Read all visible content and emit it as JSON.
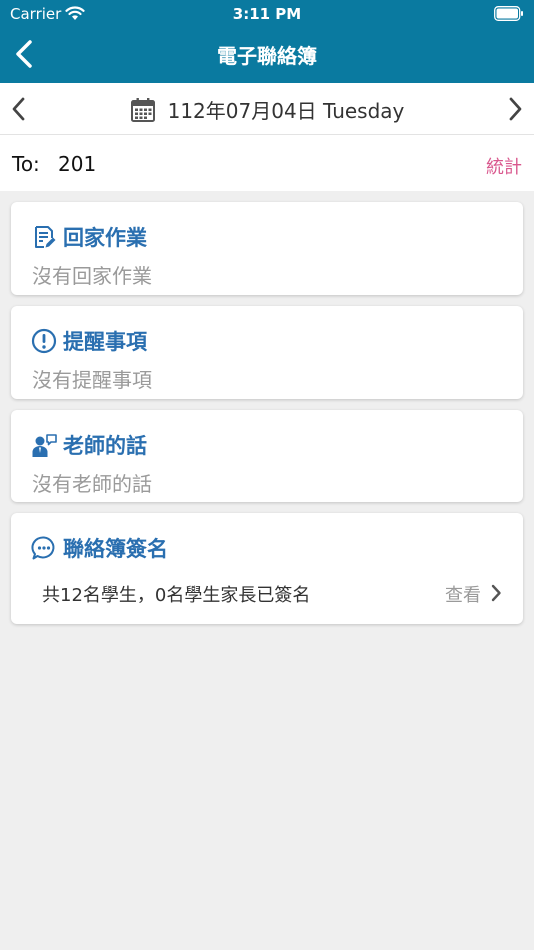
{
  "status_bar": {
    "carrier": "Carrier",
    "time": "3:11 PM"
  },
  "nav": {
    "title": "電子聯絡簿"
  },
  "date_bar": {
    "date": "112年07月04日 Tuesday"
  },
  "to_bar": {
    "label": "To:",
    "value": "201",
    "stats": "統計"
  },
  "cards": {
    "homework": {
      "title": "回家作業",
      "body": "沒有回家作業"
    },
    "reminder": {
      "title": "提醒事項",
      "body": "沒有提醒事項"
    },
    "teacher": {
      "title": "老師的話",
      "body": "沒有老師的話"
    },
    "signature": {
      "title": "聯絡簿簽名",
      "summary": "共12名學生，0名學生家長已簽名",
      "view": "查看"
    }
  },
  "colors": {
    "header": "#0a7aa0",
    "accent": "#2a6fb0",
    "stats": "#d9578d"
  },
  "icons": {
    "back": "chevron-left-icon",
    "prev": "chevron-left-icon",
    "next": "chevron-right-icon",
    "calendar": "calendar-icon",
    "homework": "document-edit-icon",
    "reminder": "exclamation-circle-icon",
    "teacher": "teacher-speech-icon",
    "signature": "chat-bubble-icon"
  }
}
